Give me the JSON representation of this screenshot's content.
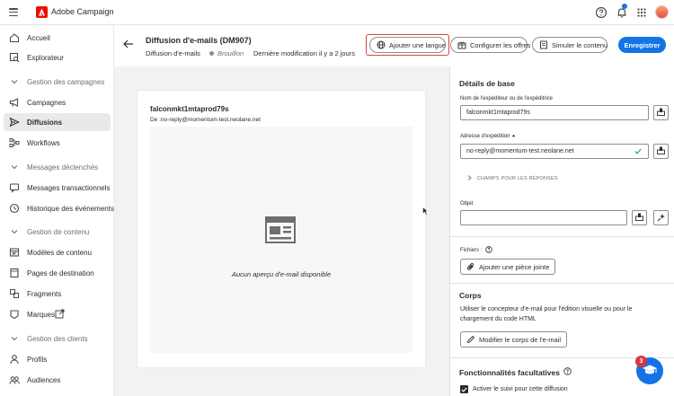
{
  "app": {
    "title": "Adobe Campaign",
    "brand_color": "#eb1000"
  },
  "topbar": {
    "icons": [
      "help-icon",
      "bell-icon",
      "apps-grid-icon"
    ],
    "notification_dot_color": "#1473e6"
  },
  "sidebar": {
    "items": [
      {
        "label": "Accueil",
        "icon": "home-icon"
      },
      {
        "label": "Explorateur",
        "icon": "explorer-icon"
      },
      {
        "label": "Gestion des campagnes",
        "icon": "chevron-down-icon",
        "section": true
      },
      {
        "label": "Campagnes",
        "icon": "megaphone-icon"
      },
      {
        "label": "Diffusions",
        "icon": "send-icon",
        "active": true
      },
      {
        "label": "Workflows",
        "icon": "workflow-icon"
      },
      {
        "label": "Messages déclenchés",
        "icon": "chevron-down-icon",
        "section": true
      },
      {
        "label": "Messages transactionnels",
        "icon": "message-icon"
      },
      {
        "label": "Historique des événements",
        "icon": "history-icon"
      },
      {
        "label": "Gestion de contenu",
        "icon": "chevron-down-icon",
        "section": true
      },
      {
        "label": "Modèles de contenu",
        "icon": "template-icon"
      },
      {
        "label": "Pages de destination",
        "icon": "page-icon"
      },
      {
        "label": "Fragments",
        "icon": "fragment-icon"
      },
      {
        "label": "Marques",
        "icon": "brand-icon"
      },
      {
        "label": "Gestion des clients",
        "icon": "chevron-down-icon",
        "section": true
      },
      {
        "label": "Profils",
        "icon": "profile-icon"
      },
      {
        "label": "Audiences",
        "icon": "audience-icon"
      }
    ]
  },
  "header": {
    "title": "Diffusion d'e-mails (DM907)",
    "subtitle": "Diffusion d'e-mails",
    "status": "Brouillon",
    "modified": "Dernière modification il y a 2 jours",
    "buttons": {
      "add_language": "Ajouter une langue",
      "configure_offers": "Configurer les offres",
      "simulate": "Simuler le contenu",
      "save": "Enregistrer"
    },
    "primary_color": "#1473e6",
    "highlight_color": "#d64545"
  },
  "preview": {
    "sender": "falconmkt1mtaprod79s",
    "from": "De :no-reply@momentum-test.neolane.net",
    "empty_message": "Aucun aperçu d'e-mail  disponible"
  },
  "panel": {
    "basic_title": "Détails de base",
    "sender_label": "Nom de l'expéditeur ou de l'expéditrice",
    "sender_value": "falconmkt1mtaprod79s",
    "address_label": "Adresse d'expédition",
    "address_required": "★",
    "address_value": "no-reply@momentum-test.neolane.net",
    "reply_fields": "CHAMPS POUR LES RÉPONSES",
    "subject_label": "Objet",
    "subject_value": "",
    "files_label": "Fichiers :",
    "attach_button": "Ajouter une pièce jointe",
    "body_title": "Corps",
    "body_text": "Utiliser le concepteur d'e-mail pour l'édition visuelle ou pour le chargement du code HTML",
    "edit_body_button": "Modifier le corps de l'e-mail",
    "optional_title": "Fonctionnalités facultatives",
    "tracking_label": "Activer le suivi pour cette diffusion",
    "tracking_checked": true
  },
  "help": {
    "badge_count": "3"
  }
}
